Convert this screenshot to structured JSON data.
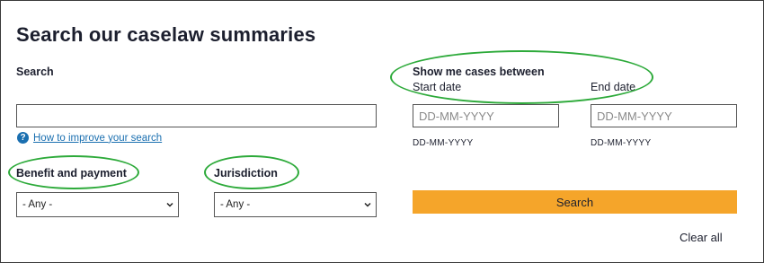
{
  "page": {
    "title": "Search our caselaw summaries"
  },
  "search": {
    "label": "Search",
    "value": "",
    "help_link": "How to improve your search",
    "help_icon": "question-circle-icon"
  },
  "date_range": {
    "heading": "Show me cases between",
    "start_label": "Start date",
    "end_label": "End date",
    "start_placeholder": "DD-MM-YYYY",
    "end_placeholder": "DD-MM-YYYY",
    "start_format_hint": "DD-MM-YYYY",
    "end_format_hint": "DD-MM-YYYY"
  },
  "filters": {
    "benefit_label": "Benefit and payment",
    "benefit_selected": "- Any -",
    "jurisdiction_label": "Jurisdiction",
    "jurisdiction_selected": "- Any -"
  },
  "actions": {
    "search_label": "Search",
    "clear_label": "Clear all"
  },
  "colors": {
    "accent": "#f5a52a",
    "link": "#1a6fb0",
    "highlight_ring": "#2daa3a"
  }
}
